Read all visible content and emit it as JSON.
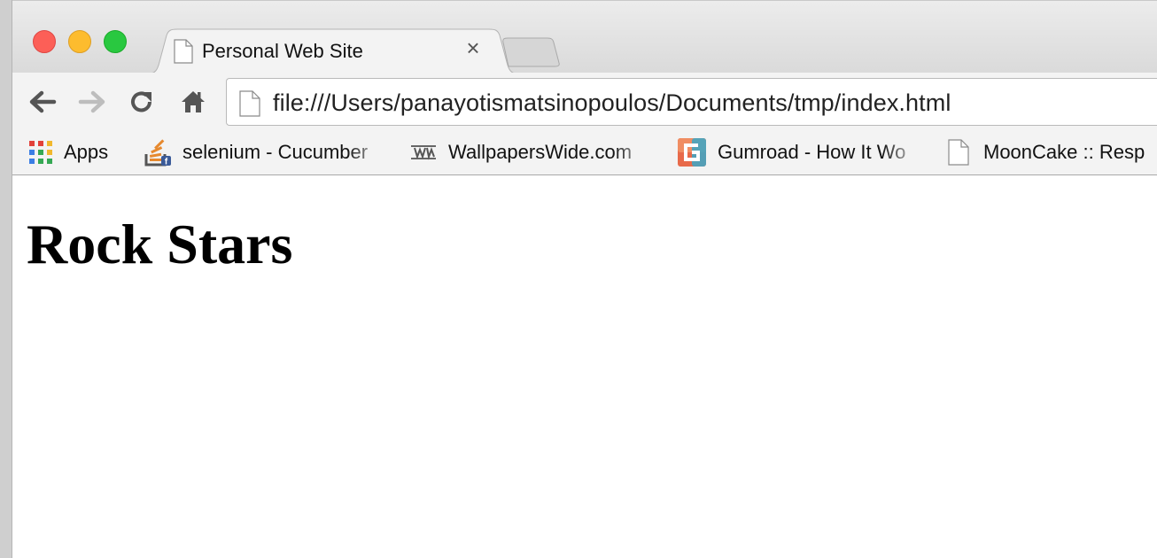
{
  "tab": {
    "title": "Personal Web Site",
    "close_glyph": "×"
  },
  "toolbar": {
    "url": "file:///Users/panayotismatsinopoulos/Documents/tmp/index.html"
  },
  "bookmarks": [
    {
      "label": "Apps",
      "icon": "apps-grid-icon"
    },
    {
      "label": "selenium - Cucumber",
      "icon": "stackoverflow-icon"
    },
    {
      "label": "WallpapersWide.com",
      "icon": "wallpaperswide-icon"
    },
    {
      "label": "Gumroad - How It Wo",
      "icon": "gumroad-icon"
    },
    {
      "label": "MoonCake :: Resp",
      "icon": "page-icon"
    }
  ],
  "page": {
    "heading": "Rock Stars"
  },
  "colors": {
    "close": "#fc5f57",
    "minimize": "#fdbc2e",
    "maximize": "#29c840"
  }
}
